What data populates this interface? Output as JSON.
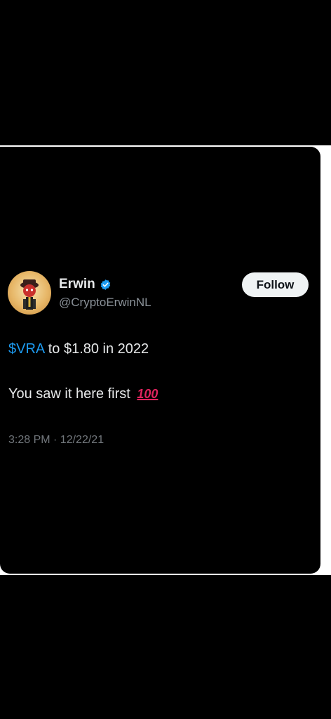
{
  "tweet": {
    "author": {
      "name": "Erwin",
      "handle": "@CryptoErwinNL",
      "verified": true,
      "avatar_icon": "avatar-icon"
    },
    "follow_button_label": "Follow",
    "lines": {
      "cashtag": "$VRA",
      "line1_rest": " to $1.80 in 2022",
      "line2_text": "You saw it here first",
      "line2_emoji": "100"
    },
    "timestamp": "3:28 PM · 12/22/21"
  },
  "colors": {
    "background": "#000000",
    "frame": "#ffffff",
    "text_primary": "#e7e9ea",
    "text_secondary": "#71767b",
    "link": "#1d9bf0",
    "verified_badge": "#1d9bf0",
    "emoji_red": "#e0245e"
  }
}
